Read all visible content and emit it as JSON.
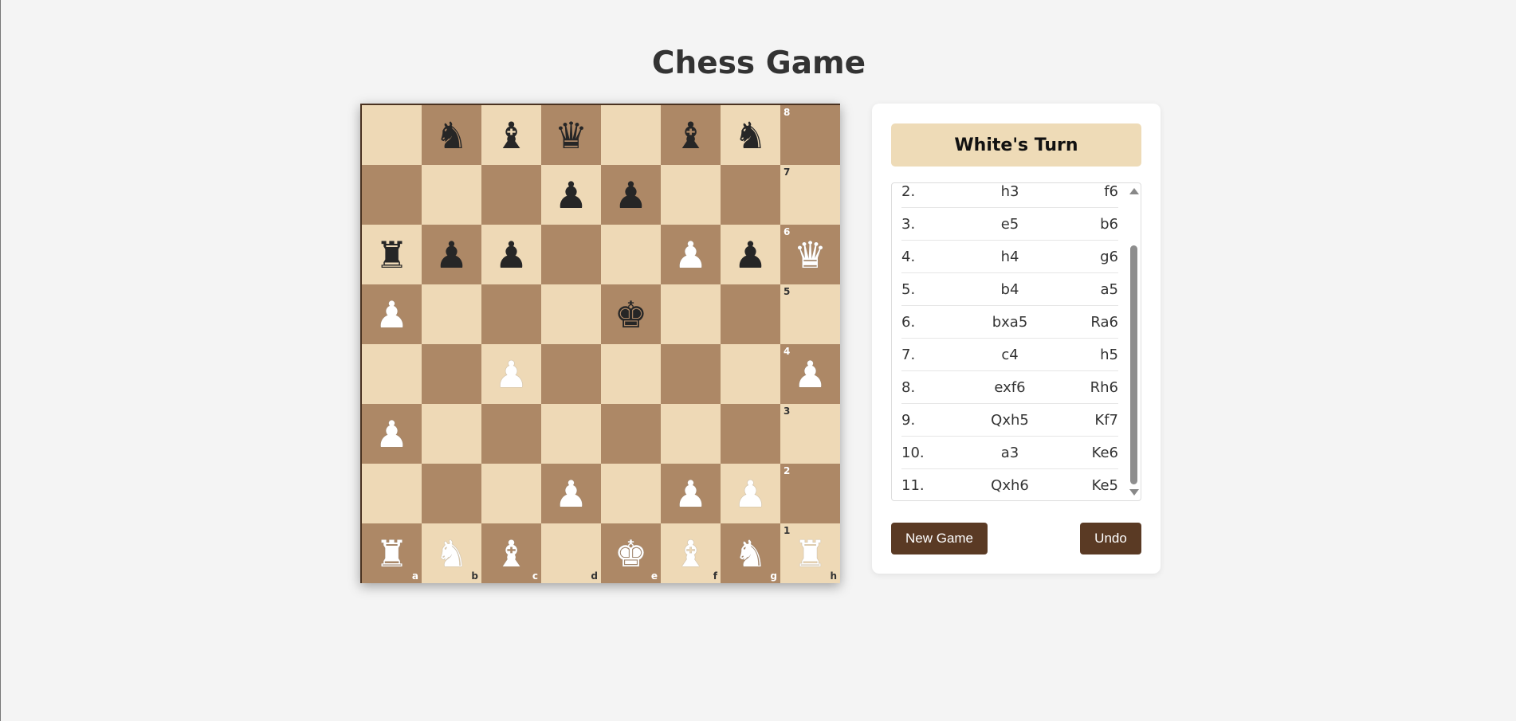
{
  "page": {
    "title": "Chess Game"
  },
  "status": {
    "turn": "White's Turn"
  },
  "board": {
    "files": [
      "a",
      "b",
      "c",
      "d",
      "e",
      "f",
      "g",
      "h"
    ],
    "ranks": [
      "8",
      "7",
      "6",
      "5",
      "4",
      "3",
      "2",
      "1"
    ],
    "rows": [
      [
        "",
        "bN",
        "bB",
        "bQ",
        "",
        "bB",
        "bN",
        ""
      ],
      [
        "",
        "",
        "",
        "bP",
        "bP",
        "",
        "",
        ""
      ],
      [
        "bR",
        "bP",
        "bP",
        "",
        "",
        "wP",
        "bP",
        "wQ"
      ],
      [
        "wP",
        "",
        "",
        "",
        "bK",
        "",
        "",
        ""
      ],
      [
        "",
        "",
        "wP",
        "",
        "",
        "",
        "",
        "wP"
      ],
      [
        "wP",
        "",
        "",
        "",
        "",
        "",
        "",
        ""
      ],
      [
        "",
        "",
        "",
        "wP",
        "",
        "wP",
        "wP",
        ""
      ],
      [
        "wR",
        "wN",
        "wB",
        "",
        "wK",
        "wB",
        "wN",
        "wR"
      ]
    ],
    "colors": {
      "light": "#eed9b6",
      "dark": "#ad8866"
    }
  },
  "moves": [
    {
      "num": "2.",
      "white": "h3",
      "black": "f6"
    },
    {
      "num": "3.",
      "white": "e5",
      "black": "b6"
    },
    {
      "num": "4.",
      "white": "h4",
      "black": "g6"
    },
    {
      "num": "5.",
      "white": "b4",
      "black": "a5"
    },
    {
      "num": "6.",
      "white": "bxa5",
      "black": "Ra6"
    },
    {
      "num": "7.",
      "white": "c4",
      "black": "h5"
    },
    {
      "num": "8.",
      "white": "exf6",
      "black": "Rh6"
    },
    {
      "num": "9.",
      "white": "Qxh5",
      "black": "Kf7"
    },
    {
      "num": "10.",
      "white": "a3",
      "black": "Ke6"
    },
    {
      "num": "11.",
      "white": "Qxh6",
      "black": "Ke5"
    }
  ],
  "controls": {
    "new_game": "New Game",
    "undo": "Undo"
  }
}
